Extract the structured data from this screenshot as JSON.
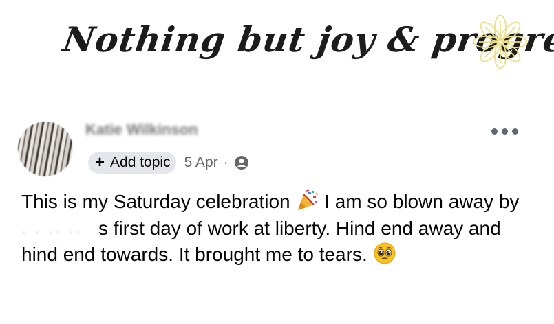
{
  "banner": {
    "title": "Nothing but joy & progress",
    "flower_icon": "flower-icon",
    "flower_color": "#ecdf8a"
  },
  "post": {
    "author_name": "Katie Wilkinson",
    "add_topic_label": "Add topic",
    "date": "5 Apr",
    "separator": "·",
    "audience_icon": "friends-icon",
    "more_icon": "more-options-icon",
    "message_part1": "This is my Saturday celebration ",
    "celebration_emoji_icon": "party-popper-emoji-icon",
    "message_part2": " I am so blown away by ",
    "redacted_name": "· · ·· ··",
    "message_part3": "s first day of work at liberty. Hind end away and hind end towards. It brought me to tears. ",
    "teary_emoji_icon": "pleading-face-emoji-icon"
  },
  "colors": {
    "text": "#050505",
    "secondary_text": "#65676b",
    "chip_bg": "#e4e6eb"
  }
}
